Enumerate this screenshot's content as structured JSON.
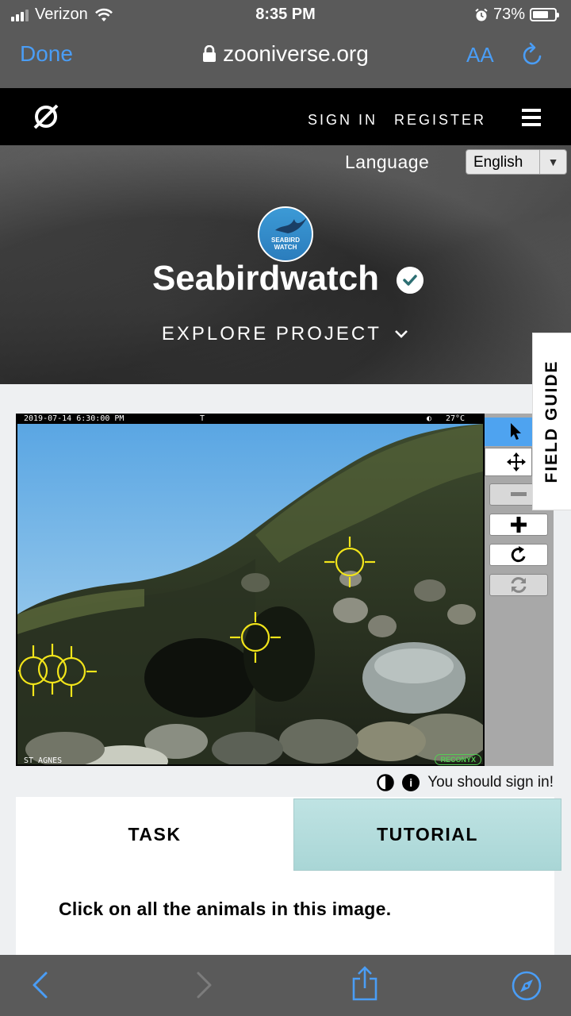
{
  "status_bar": {
    "carrier": "Verizon",
    "time": "8:35 PM",
    "battery": "73%",
    "battery_level": 0.73
  },
  "browser": {
    "done_label": "Done",
    "url": "zooniverse.org",
    "text_size_label": "AA"
  },
  "nav": {
    "sign_in": "SIGN IN",
    "register": "REGISTER"
  },
  "hero": {
    "language_label": "Language",
    "language_value": "English",
    "avatar_text_line1": "SEABIRD",
    "avatar_text_line2": "WATCH",
    "project_title": "Seabirdwatch",
    "explore_label": "EXPLORE PROJECT"
  },
  "field_guide_label": "FIELD GUIDE",
  "subject": {
    "timestamp": "2019-07-14  6:30:00 PM",
    "t_mark": "T",
    "temperature": "27°C",
    "location": "ST AGNES",
    "camera_brand": "RECONYX"
  },
  "subject_meta": {
    "sign_in_message": "You should sign in!",
    "info_icon_text": "i"
  },
  "task_panel": {
    "tab_task": "TASK",
    "tab_tutorial": "TUTORIAL",
    "instruction": "Click on all the animals in this image."
  },
  "colors": {
    "ios_blue": "#4a9df5",
    "tutorial_teal": "#a9d6d6",
    "marker_yellow": "#f2e51a",
    "active_tool": "#4ea3f0"
  }
}
